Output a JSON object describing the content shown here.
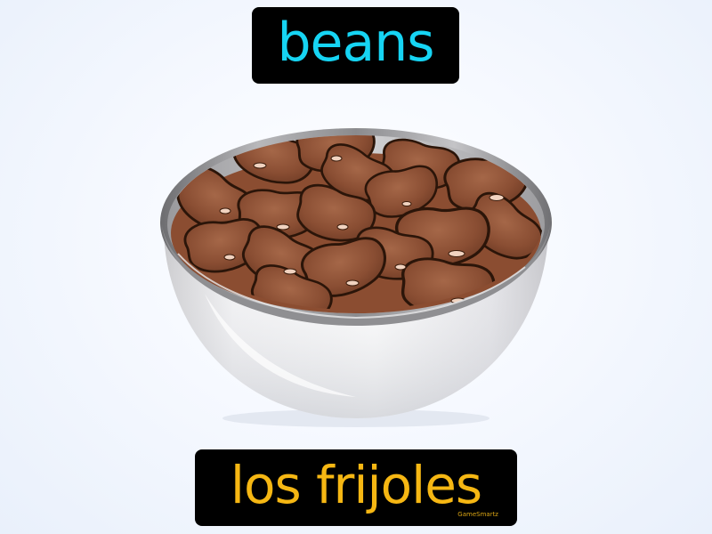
{
  "english_label": {
    "text": "beans",
    "color": "#16d4f3"
  },
  "spanish_label": {
    "text": "los frijoles",
    "color": "#f6b713"
  },
  "brand": {
    "text": "GameSmartz"
  },
  "illustration": {
    "subject": "bowl-of-beans-icon"
  }
}
